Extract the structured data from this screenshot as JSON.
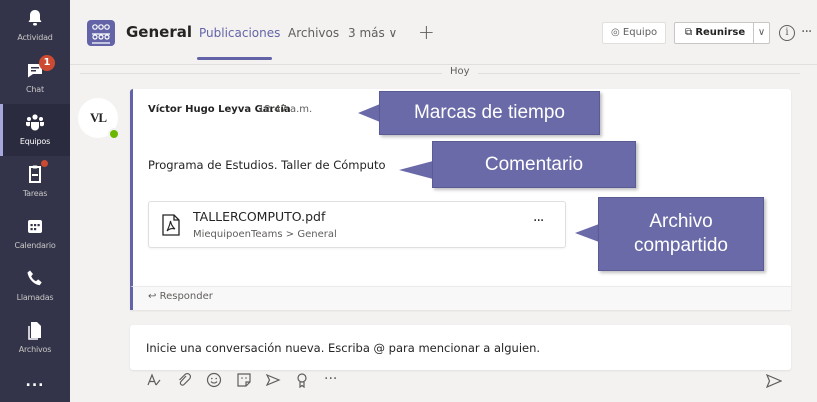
{
  "appbar": {
    "items": [
      {
        "label": "Actividad",
        "icon": "bell-icon"
      },
      {
        "label": "Chat",
        "icon": "chat-icon",
        "badge": "1"
      },
      {
        "label": "Equipos",
        "icon": "teams-icon"
      },
      {
        "label": "Tareas",
        "icon": "tasks-icon"
      },
      {
        "label": "Calendario",
        "icon": "calendar-icon"
      },
      {
        "label": "Llamadas",
        "icon": "phone-icon"
      },
      {
        "label": "Archivos",
        "icon": "files-icon"
      }
    ],
    "more": "..."
  },
  "header": {
    "team_name": "General",
    "tabs": [
      {
        "label": "Publicaciones",
        "active": true
      },
      {
        "label": "Archivos",
        "active": false
      },
      {
        "label": "3 más ∨",
        "active": false
      }
    ],
    "add_tab": "+",
    "equipo": "Equipo",
    "reunirse": "Reunirse",
    "reunirse_caret": "∨",
    "info": "i",
    "more": "···"
  },
  "feed": {
    "date_separator": "Hoy",
    "message": {
      "avatar_initials": "VL",
      "author": "Víctor Hugo Leyva García",
      "timestamp": "12:47 a.m.",
      "text": "Programa de Estudios. Taller de Cómputo",
      "attachment": {
        "name": "TALLERCOMPUTO.pdf",
        "path": "MiequipoenTeams > General",
        "more": "···"
      },
      "reply_label": "Responder"
    }
  },
  "compose": {
    "placeholder": "Inicie una conversación nueva. Escriba @ para mencionar a alguien.",
    "more": "···"
  },
  "callouts": {
    "timestamp": "Marcas de tiempo",
    "comment": "Comentario",
    "shared_file_line1": "Archivo",
    "shared_file_line2": "compartido"
  },
  "colors": {
    "brand": "#6264a7",
    "appbar": "#33344a",
    "callout": "#6a6aa8",
    "presence": "#6bb700",
    "badge": "#cc4a31"
  }
}
